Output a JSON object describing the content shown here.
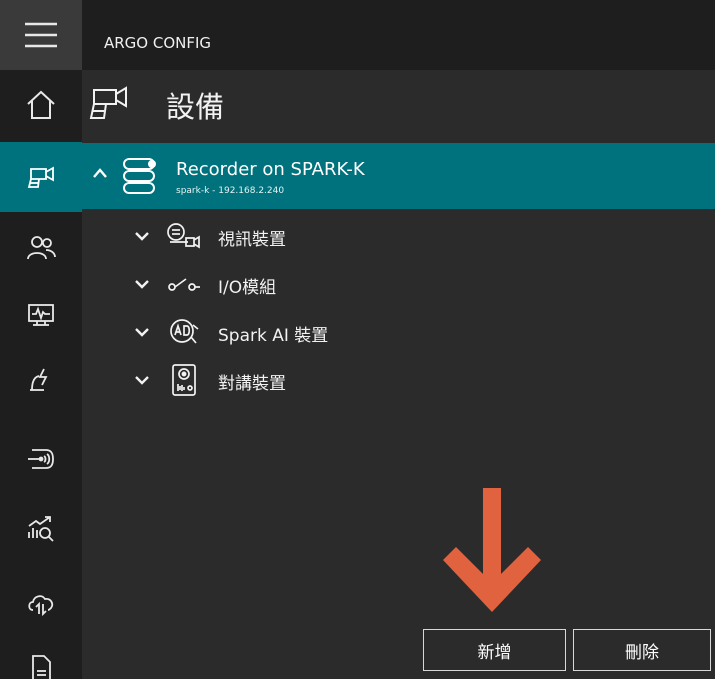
{
  "app": {
    "title": "ARGO CONFIG"
  },
  "sidebar": {
    "items": [
      {
        "icon": "home-icon"
      },
      {
        "icon": "device-camera-icon",
        "active": true
      },
      {
        "icon": "users-icon"
      },
      {
        "icon": "monitor-icon"
      },
      {
        "icon": "alarm-lightning-icon"
      },
      {
        "icon": "signal-port-icon"
      },
      {
        "icon": "analytics-search-icon"
      },
      {
        "icon": "cloud-sync-icon"
      },
      {
        "icon": "document-icon"
      }
    ]
  },
  "page": {
    "title": "設備"
  },
  "tree": {
    "root": {
      "name": "Recorder on SPARK-K",
      "sub": "spark-k - 192.168.2.240"
    },
    "children": [
      {
        "label": "視訊裝置",
        "icon": "video-device-icon"
      },
      {
        "label": "I/O模組",
        "icon": "io-module-icon"
      },
      {
        "label": "Spark AI 裝置",
        "icon": "ai-device-icon"
      },
      {
        "label": "對講裝置",
        "icon": "intercom-device-icon"
      }
    ]
  },
  "footer": {
    "add_label": "新增",
    "delete_label": "刪除"
  },
  "colors": {
    "accent": "#00727d",
    "arrow": "#e0623e",
    "background": "#2b2b2b",
    "sidebar": "#1e1e1e"
  }
}
